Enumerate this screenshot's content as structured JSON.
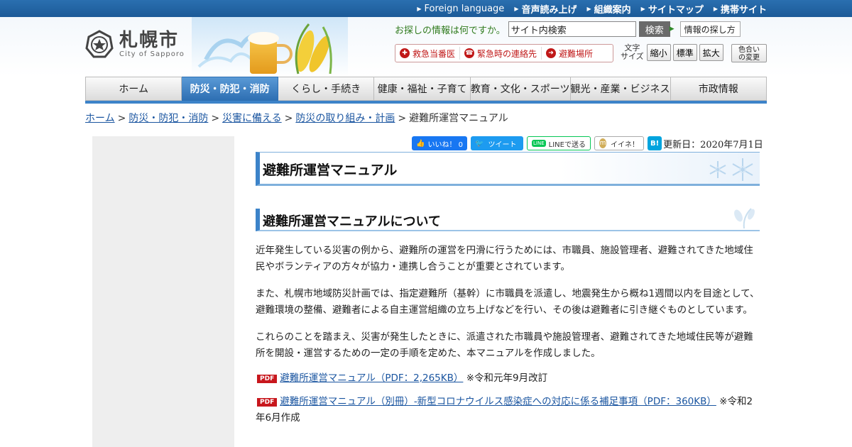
{
  "topbar": {
    "links": [
      "Foreign language",
      "音声読み上げ",
      "組織案内",
      "サイトマップ",
      "携帯サイト"
    ]
  },
  "header": {
    "logo_ja": "札幌市",
    "logo_en": "City of Sapporo",
    "search_prompt": "お探しの情報は何ですか。",
    "search_value": "サイト内検索",
    "search_button": "検索",
    "find_info_button": "情報の探し方",
    "emergency": [
      "救急当番医",
      "緊急時の連絡先",
      "避難場所"
    ],
    "font_size_label_1": "文字",
    "font_size_label_2": "サイズ",
    "font_size_buttons": [
      "縮小",
      "標準",
      "拡大"
    ],
    "color_change_1": "色合い",
    "color_change_2": "の変更"
  },
  "nav": {
    "items": [
      "ホーム",
      "防災・防犯・消防",
      "くらし・手続き",
      "健康・福祉・子育て",
      "教育・文化・スポーツ",
      "観光・産業・ビジネス",
      "市政情報"
    ],
    "active_index": 1
  },
  "breadcrumb": {
    "links": [
      "ホーム",
      "防災・防犯・消防",
      "災害に備える",
      "防災の取り組み・計画"
    ],
    "current": "避難所運営マニュアル",
    "separator": ">"
  },
  "social": {
    "facebook": "いいね！ 0",
    "twitter": "ツイート",
    "line": "LINEで送る",
    "line_icon": "LINE",
    "mixi": "イイネ！",
    "mixi_icon": "m",
    "hatena": "B!",
    "updated": "更新日：2020年7月1日"
  },
  "main": {
    "title": "避難所運営マニュアル",
    "section_title": "避難所運営マニュアルについて",
    "paragraphs": [
      "近年発生している災害の例から、避難所の運営を円滑に行うためには、市職員、施設管理者、避難されてきた地域住民やボランティアの方々が協力・連携し合うことが重要とされています。",
      "また、札幌市地域防災計画では、指定避難所（基幹）に市職員を派遣し、地震発生から概ね1週間以内を目途として、避難環境の整備、避難者による自主運営組織の立ち上げなどを行い、その後は避難者に引き継ぐものとしています。",
      "これらのことを踏まえ、災害が発生したときに、派遣された市職員や施設管理者、避難されてきた地域住民等が避難所を開設・運営するための一定の手順を定めた、本マニュアルを作成しました。"
    ],
    "pdf_badge": "PDF",
    "files": [
      {
        "label": "避難所運営マニュアル（PDF：2,265KB）",
        "note": "※令和元年9月改訂"
      },
      {
        "label": "避難所運営マニュアル（別冊）-新型コロナウイルス感染症への対応に係る補足事項（PDF：360KB）",
        "note": "※令和2年6月作成"
      }
    ]
  },
  "colors": {
    "topbar": "#1c5a98",
    "nav_active": "#2e6fb3",
    "link": "#1a55a0",
    "emergency": "#c01818",
    "pdf_badge": "#c8171d"
  }
}
